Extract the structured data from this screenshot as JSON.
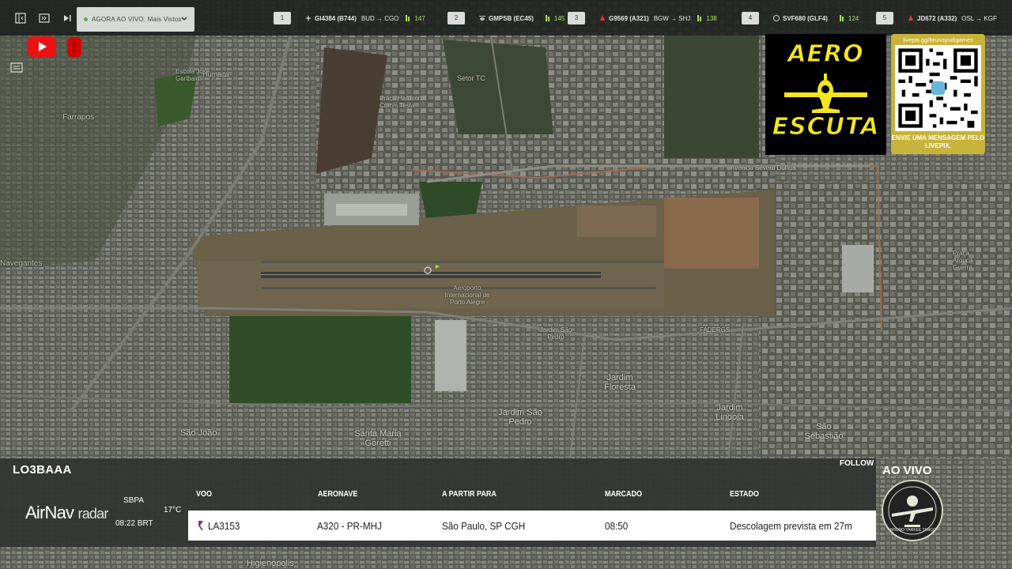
{
  "topbar": {
    "feed_selector": "AGORA AO VIVO: Mais Vistos",
    "ticker": [
      {
        "rank": "1",
        "flight": "GI4384 (B744)",
        "route": "BUD → CGO",
        "count": "147",
        "icon": "plane-icon"
      },
      {
        "rank": "2",
        "flight": "GMPSB (EC45)",
        "route": "",
        "count": "145",
        "icon": "helicopter-icon"
      },
      {
        "rank": "3",
        "flight": "G9569 (A321)",
        "route": "BGW → SHJ",
        "count": "138",
        "icon": "airline-logo-icon"
      },
      {
        "rank": "4",
        "flight": "SVF680 (GLF4)",
        "route": "",
        "count": "124",
        "icon": "airline-logo-icon"
      },
      {
        "rank": "5",
        "flight": "JD672 (A332)",
        "route": "OSL → KGF",
        "count": "",
        "icon": "airline-logo-icon"
      }
    ]
  },
  "overlay": {
    "aero_top": "AERO",
    "aero_bottom": "ESCUTA",
    "qr_url": "livepix.gg/brunoyudigames",
    "qr_message": "ENVIE UMA MENSAGEM PELO LIVEPIX."
  },
  "map": {
    "labels": [
      "Humaitá",
      "Farrapos",
      "Escola Jose Garibaldi",
      "Praça Harrison Curtys Testa",
      "Setor TC",
      "Aeroporto Internacional de Porto Alegre",
      "Jardim São Pedro",
      "Jardim Floresta",
      "Jardim São Pedro",
      "Jardim Lindoia",
      "Santa Maria Goretti",
      "São João",
      "São Sebastião",
      "Avenida Severo Dullius",
      "Praça Arouca Guerra",
      "FADERGS",
      "Higienópolis",
      "Navegantes"
    ]
  },
  "flight_panel": {
    "callsign": "LO3BAAA",
    "follow_label": "FOLLOW",
    "brand": "AirNav",
    "brand_suffix": "radar",
    "airport_code": "SBPA",
    "local_time": "08:22 BRT",
    "temperature": "17°C",
    "columns": [
      "VOO",
      "AERONAVE",
      "A PARTIR PARA",
      "MARCADO",
      "ESTADO"
    ],
    "row": {
      "flight": "LA3153",
      "aircraft": "A320 - PR-MHJ",
      "destination": "São Paulo, SP CGH",
      "scheduled": "08:50",
      "status": "Descolagem prevista em 27m"
    }
  },
  "live": {
    "label": "AO VIVO",
    "badge_text": "BRUNO YARKEE TANGO"
  },
  "colors": {
    "ticker_count": "#a7e05a",
    "aero_yellow": "#f4e61f",
    "qr_gold": "#c8b43a",
    "youtube_red": "#e11"
  }
}
